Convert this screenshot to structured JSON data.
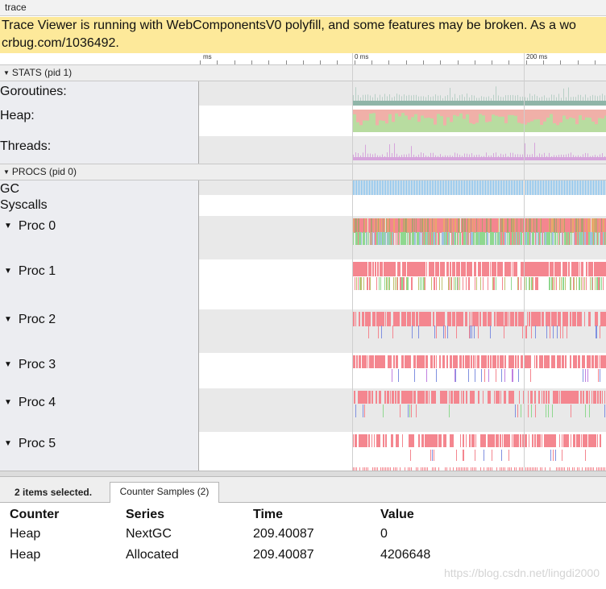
{
  "window": {
    "title": "trace"
  },
  "warning": {
    "line1": "Trace Viewer is running with WebComponentsV0 polyfill, and some features may be broken. As a wo",
    "line2": "crbug.com/1036492."
  },
  "ruler": {
    "labels": [
      "ms",
      "0 ms",
      "200 ms"
    ]
  },
  "stats": {
    "header": "STATS (pid 1)",
    "rows": [
      {
        "label": "Goroutines:"
      },
      {
        "label": "Heap:"
      },
      {
        "label": "Threads:"
      }
    ]
  },
  "procs": {
    "header": "PROCS (pid 0)",
    "rows": [
      {
        "label": "GC"
      },
      {
        "label": "Syscalls"
      },
      {
        "label": "Proc 0"
      },
      {
        "label": "Proc 1"
      },
      {
        "label": "Proc 2"
      },
      {
        "label": "Proc 3"
      },
      {
        "label": "Proc 4"
      },
      {
        "label": "Proc 5"
      }
    ]
  },
  "details": {
    "selection": "2 items selected.",
    "tab": "Counter Samples (2)",
    "columns": [
      "Counter",
      "Series",
      "Time",
      "Value"
    ],
    "rows": [
      [
        "Heap",
        "NextGC",
        "209.40087",
        "0"
      ],
      [
        "Heap",
        "Allocated",
        "209.40087",
        "4206648"
      ]
    ]
  },
  "watermark": "https://blog.csdn.net/lingdi2000",
  "colors": {
    "warning_bg": "#fde99a",
    "gc": "#7ec0f0",
    "slice_red": "#f4868f",
    "slice_green": "#8fd88f",
    "slice_orange": "#e8a86a",
    "heap_green": "#b8dca0",
    "heap_red": "#f0b0a8",
    "threads": "#d6a5dc",
    "goroutines": "#8fb5a8"
  }
}
